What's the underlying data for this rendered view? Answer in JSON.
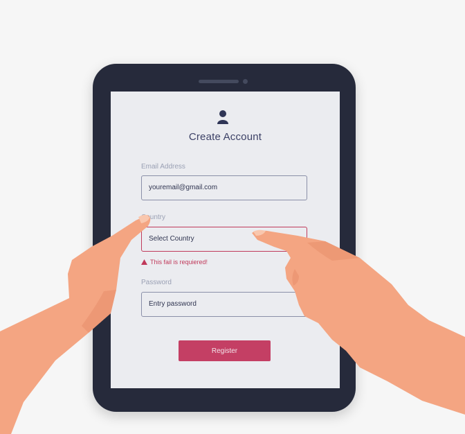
{
  "form": {
    "title": "Create Account",
    "email_label": "Email Address",
    "email_value": "youremail@gmail.com",
    "country_label": "Country",
    "country_value": "Select Country",
    "country_error": "This fail is requiered!",
    "password_label": "Password",
    "password_placeholder": "Entry password",
    "register_label": "Register"
  },
  "colors": {
    "tablet_frame": "#262a3b",
    "screen_bg": "#ebecf0",
    "accent": "#c43f64",
    "skin": "#f4a582"
  },
  "icons": [
    "user-icon",
    "warning-icon"
  ]
}
